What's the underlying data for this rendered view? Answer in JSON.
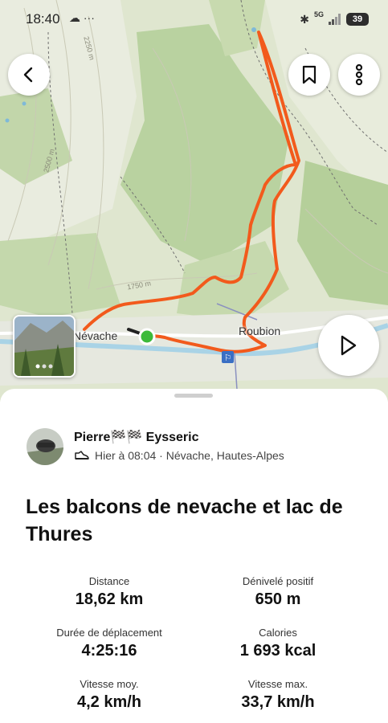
{
  "status_bar": {
    "time": "18:40",
    "left_icons": "☁ ···",
    "network": "5G",
    "battery": "39"
  },
  "map": {
    "labels": {
      "town_left": "Névache",
      "town_right": "Roubion"
    },
    "contours": [
      "2250 m",
      "2500 m",
      "1750 m"
    ],
    "route_color": "#f25a1c",
    "start_marker_color": "#3cba3a"
  },
  "activity": {
    "user_name": "Pierre🏁🏁 Eysseric",
    "meta": "Hier à 08:04 · Névache, Hautes-Alpes",
    "title": "Les balcons de nevache et lac de Thures",
    "stats": [
      {
        "label": "Distance",
        "value": "18,62 km"
      },
      {
        "label": "Dénivelé positif",
        "value": "650 m"
      },
      {
        "label": "Durée de déplacement",
        "value": "4:25:16"
      },
      {
        "label": "Calories",
        "value": "1 693 kcal"
      },
      {
        "label": "Vitesse moy.",
        "value": "4,2 km/h"
      },
      {
        "label": "Vitesse max.",
        "value": "33,7 km/h"
      }
    ]
  },
  "icons": {
    "back": "chevron-left-icon",
    "bookmark": "bookmark-icon",
    "more": "more-vertical-icon",
    "play": "play-icon",
    "shoe": "shoe-icon"
  }
}
